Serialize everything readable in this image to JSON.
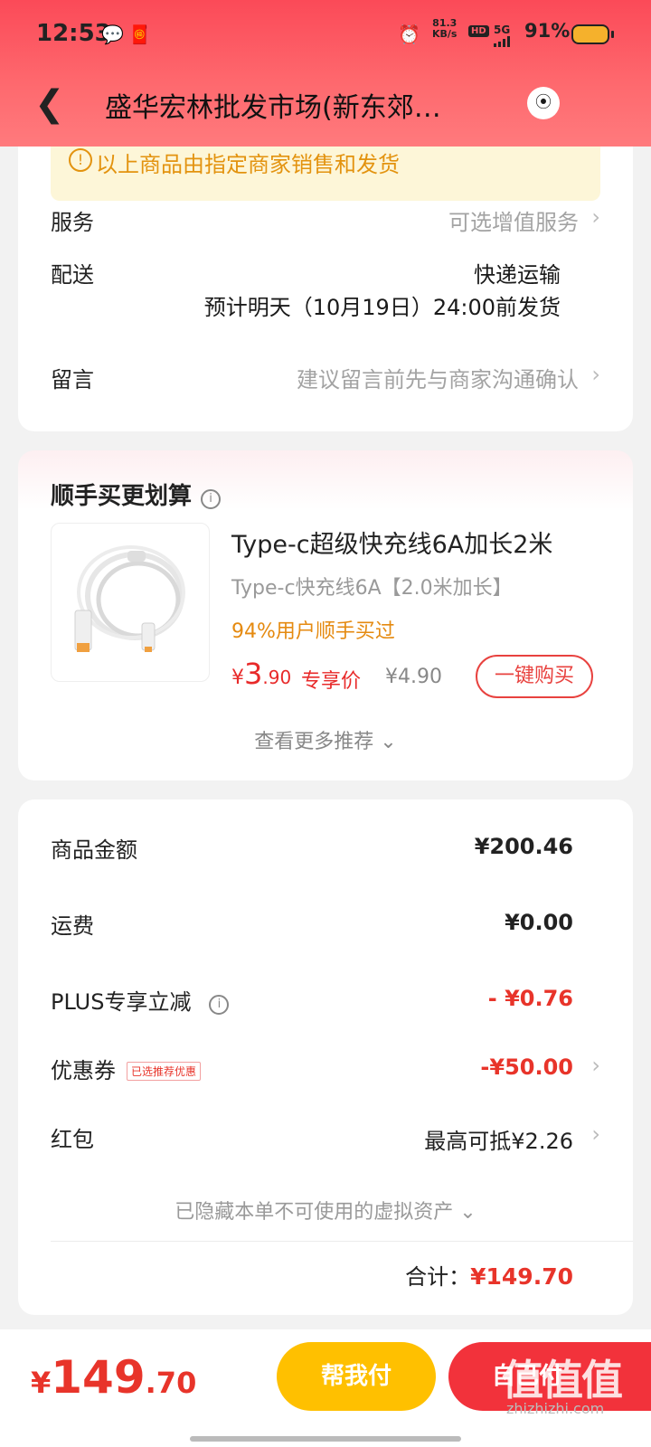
{
  "status_bar": {
    "time": "12:53",
    "net_speed_value": "81.3",
    "net_speed_unit": "KB/s",
    "hd": "HD",
    "network": "5G",
    "battery_pct": "91%"
  },
  "nav": {
    "title": "盛华宏林批发市场(新东郊…"
  },
  "order": {
    "notice": "以上商品由指定商家销售和发货",
    "service_label": "服务",
    "service_value": "可选增值服务",
    "delivery_label": "配送",
    "delivery_method": "快递运输",
    "delivery_eta": "预计明天（10月19日）24:00前发货",
    "message_label": "留言",
    "message_placeholder": "建议留言前先与商家沟通确认"
  },
  "upsell": {
    "title": "顺手买更划算",
    "product_name": "Type-c超级快充线6A加长2米",
    "product_spec": "Type-c快充线6A【2.0米加长】",
    "popularity": "94%用户顺手买过",
    "price_symbol": "¥",
    "price_int": "3",
    "price_dec": ".90",
    "price_tag": "专享价",
    "original_price": "¥4.90",
    "buy_label": "一键购买",
    "more_label": "查看更多推荐"
  },
  "summary": {
    "goods_label": "商品金额",
    "goods_value": "¥200.46",
    "shipping_label": "运费",
    "shipping_value": "¥0.00",
    "plus_label": "PLUS专享立减",
    "plus_value": "- ¥0.76",
    "coupon_label": "优惠券",
    "coupon_tag": "已选推荐优惠",
    "coupon_value": "-¥50.00",
    "redpacket_label": "红包",
    "redpacket_value": "最高可抵¥2.26",
    "hidden_assets": "已隐藏本单不可使用的虚拟资产",
    "total_label": "合计：",
    "total_value": "¥149.70"
  },
  "footer": {
    "price_symbol": "¥",
    "price_int": "149",
    "price_dec": ".70",
    "help_pay": "帮我付",
    "self_pay": "自己付",
    "watermark": "值值值",
    "watermark_url": "zhizhizhi.com"
  },
  "colors": {
    "header": "#fb4a58",
    "price_red": "#e8342a",
    "accent_orange": "#e58a10",
    "help_btn": "#ffc000",
    "pay_btn": "#f2323b"
  }
}
